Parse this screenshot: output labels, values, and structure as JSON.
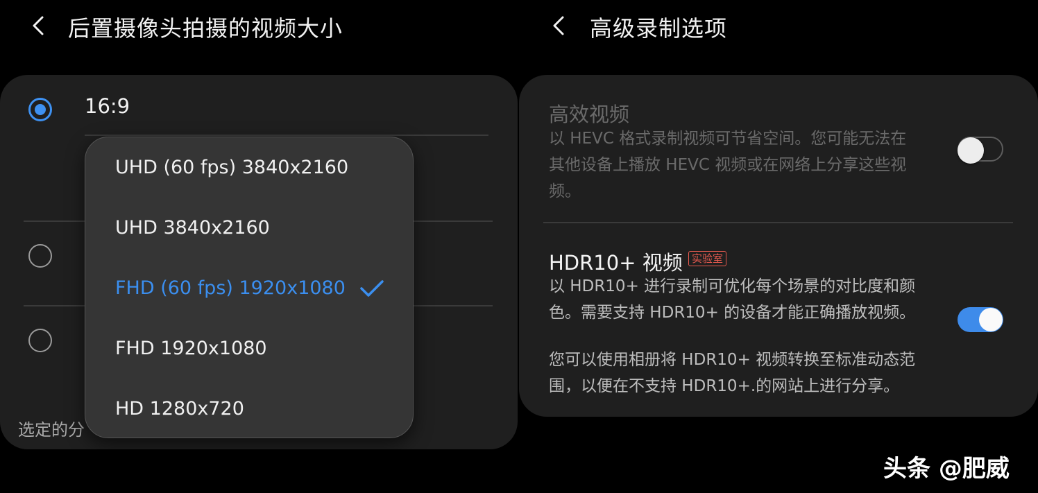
{
  "left_panel": {
    "title": "后置摄像头拍摄的视频大小",
    "ratio_options": [
      {
        "label": "16:9",
        "checked": true
      },
      {
        "label": "",
        "checked": false
      },
      {
        "label": "",
        "checked": false
      }
    ],
    "bottom_text": "选定的分",
    "resolution_menu": {
      "items": [
        {
          "label": "UHD (60 fps) 3840x2160",
          "selected": false
        },
        {
          "label": "UHD 3840x2160",
          "selected": false
        },
        {
          "label": "FHD (60 fps) 1920x1080",
          "selected": true
        },
        {
          "label": "FHD 1920x1080",
          "selected": false
        },
        {
          "label": "HD 1280x720",
          "selected": false
        }
      ],
      "selected_color": "#3b8ff0"
    }
  },
  "right_panel": {
    "title": "高级录制选项",
    "settings": [
      {
        "title": "高效视频",
        "description_lines": [
          "以 HEVC 格式录制视频可节省空间。您可能无法在",
          "其他设备上播放 HEVC 视频或在网络上分享这些视",
          "频。"
        ],
        "enabled": false,
        "toggle_on": false
      },
      {
        "title": "HDR10+ 视频",
        "badge": "实验室",
        "description_lines": [
          "以 HDR10+ 进行录制可优化每个场景的对比度和颜",
          "色。需要支持 HDR10+ 的设备才能正确播放视频。"
        ],
        "note_lines": [
          "您可以使用相册将 HDR10+ 视频转换至标准动态范",
          "围，以便在不支持 HDR10+.的网站上进行分享。"
        ],
        "enabled": true,
        "toggle_on": true
      }
    ]
  },
  "watermark": "头条 @肥威",
  "colors": {
    "accent": "#3e8bea",
    "background": "#000000",
    "card": "#1f1f1f",
    "badge": "#e85a4f"
  },
  "icons": {
    "back": "chevron-left-icon",
    "check": "check-icon"
  }
}
